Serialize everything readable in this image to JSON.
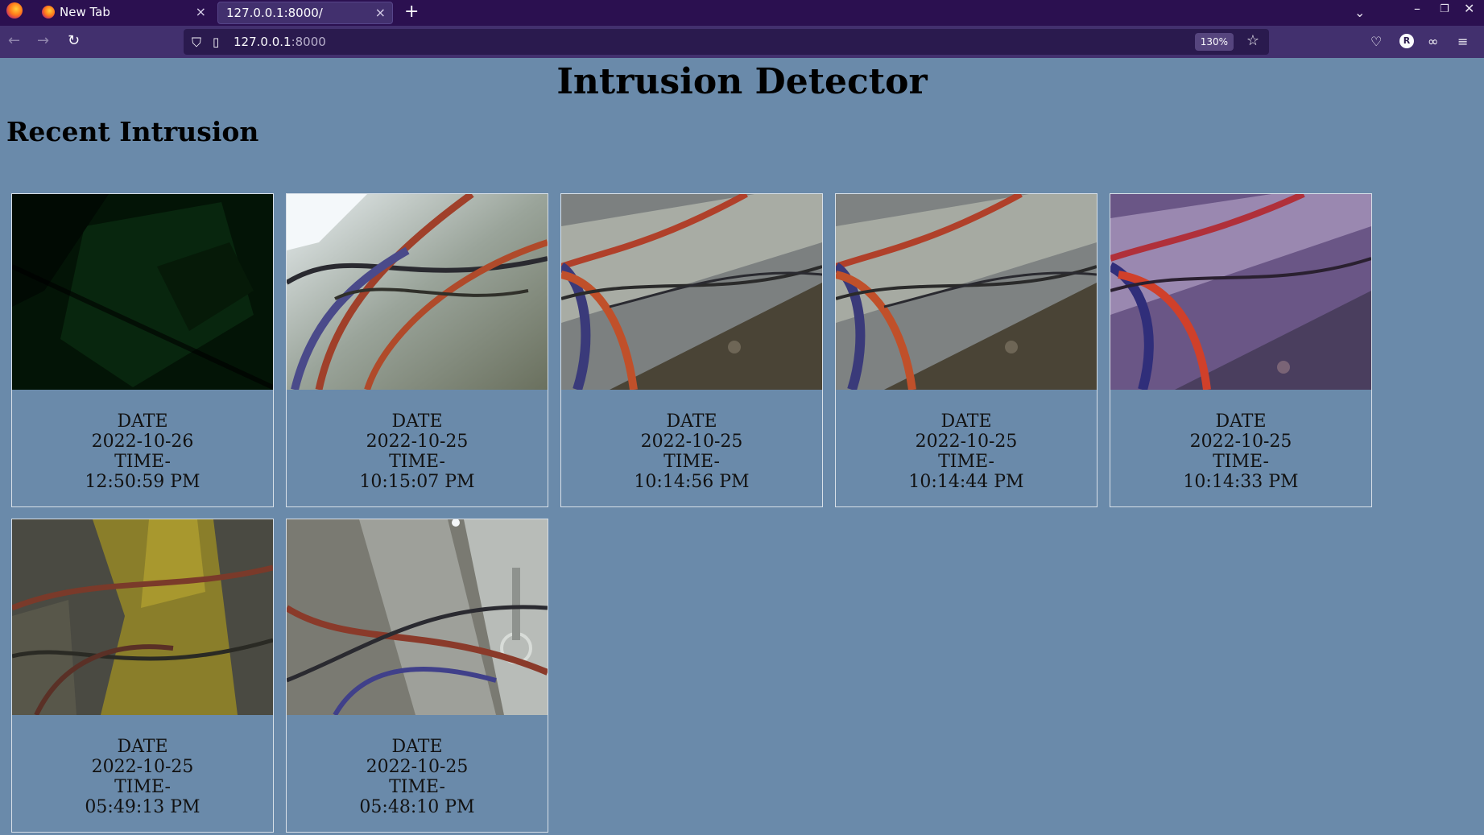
{
  "browser": {
    "tabs": [
      {
        "label": "New Tab",
        "close": "×"
      },
      {
        "label": "127.0.0.1:8000/",
        "close": "×"
      }
    ],
    "new_tab": "+",
    "url": {
      "host": "127.0.0.1",
      "port": ":8000"
    },
    "zoom": "130%",
    "profile_initial": "R"
  },
  "page": {
    "title": "Intrusion Detector",
    "section_title": "Recent Intrusion"
  },
  "intrusions": [
    {
      "date_label": "DATE",
      "date": "2022-10-26",
      "time_label": "TIME-",
      "time": "12:50:59 PM"
    },
    {
      "date_label": "DATE",
      "date": "2022-10-25",
      "time_label": "TIME-",
      "time": "10:15:07 PM"
    },
    {
      "date_label": "DATE",
      "date": "2022-10-25",
      "time_label": "TIME-",
      "time": "10:14:56 PM"
    },
    {
      "date_label": "DATE",
      "date": "2022-10-25",
      "time_label": "TIME-",
      "time": "10:14:44 PM"
    },
    {
      "date_label": "DATE",
      "date": "2022-10-25",
      "time_label": "TIME-",
      "time": "10:14:33 PM"
    },
    {
      "date_label": "DATE",
      "date": "2022-10-25",
      "time_label": "TIME-",
      "time": "05:49:13 PM"
    },
    {
      "date_label": "DATE",
      "date": "2022-10-25",
      "time_label": "TIME-",
      "time": "05:48:10 PM"
    }
  ]
}
